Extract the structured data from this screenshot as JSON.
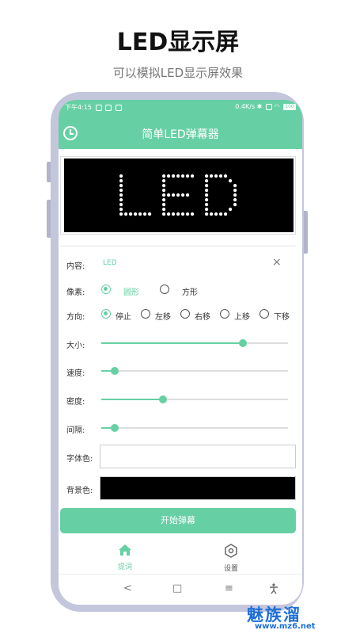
{
  "promo": {
    "title": "LED显示屏",
    "subtitle": "可以模拟LED显示屏效果"
  },
  "status_bar": {
    "time": "下午4:15",
    "network": "0.4K/s",
    "battery": "100"
  },
  "app": {
    "title": "简单LED弹幕器",
    "history_icon": "clock-icon"
  },
  "led_preview": {
    "text": "LED",
    "text_color": "#ffffff",
    "background": "#000000"
  },
  "form": {
    "content_label": "内容:",
    "content_value": "LED",
    "clear_symbol": "×",
    "pixel_label": "像素:",
    "pixel_options": [
      "圆形",
      "方形"
    ],
    "pixel_selected": "圆形",
    "direction_label": "方向:",
    "direction_options": [
      "停止",
      "左移",
      "右移",
      "上移",
      "下移"
    ],
    "direction_selected": "停止",
    "size_label": "大小:",
    "size_value": 0.76,
    "speed_label": "速度:",
    "speed_value": 0.07,
    "density_label": "密度:",
    "density_value": 0.33,
    "gap_label": "间隔:",
    "gap_value": 0.07,
    "font_color_label": "字体色:",
    "font_color": "#ffffff",
    "bg_color_label": "背景色:",
    "bg_color": "#000000"
  },
  "start_button": "开始弹幕",
  "bottom_tabs": [
    {
      "label": "提词",
      "icon": "home-icon",
      "active": true
    },
    {
      "label": "设置",
      "icon": "settings-icon",
      "active": false
    }
  ],
  "nav_bar": {
    "back": "<",
    "home": "□",
    "menu": "≡",
    "accessibility": "accessibility-icon"
  },
  "watermark": {
    "text": "魅族溜",
    "url": "www.mz6.net"
  },
  "colors": {
    "accent": "#66d0a4",
    "phone_frame": "#c4c6dc"
  }
}
